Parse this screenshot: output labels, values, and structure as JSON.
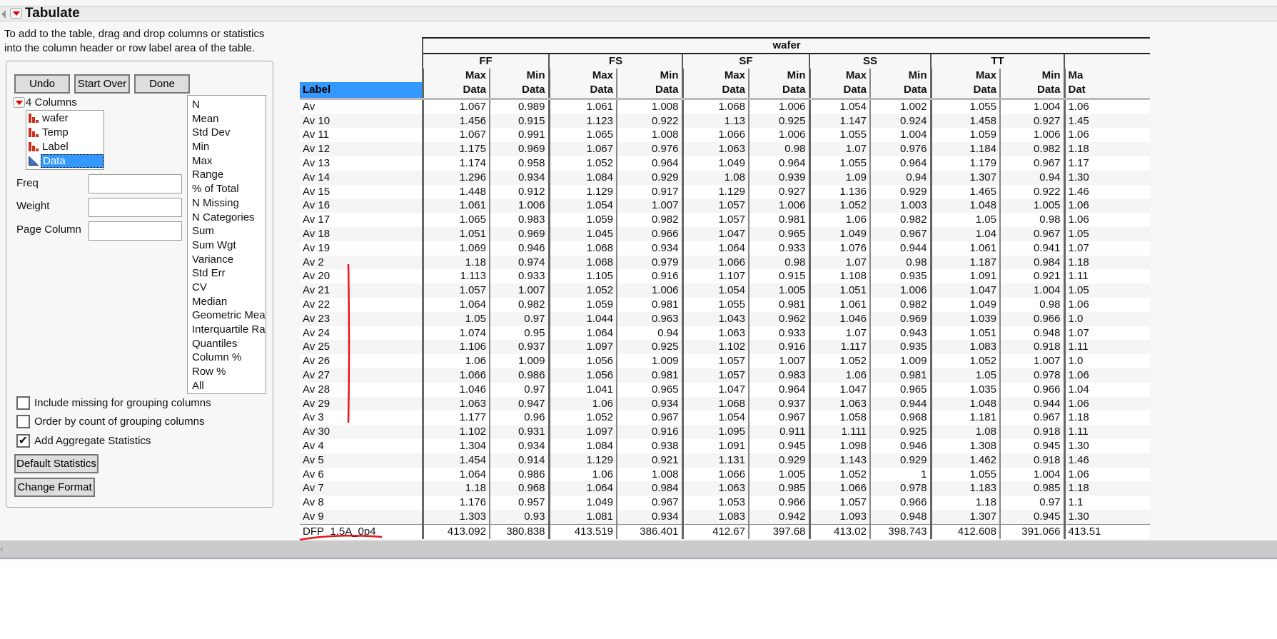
{
  "window": {
    "title": "Tabulate",
    "instructions_line1": "To add to the table, drag and drop columns or statistics",
    "instructions_line2": "into the column header or row label area of the table."
  },
  "buttons": {
    "undo": "Undo",
    "start_over": "Start Over",
    "done": "Done",
    "default_statistics": "Default Statistics",
    "change_format": "Change Format"
  },
  "columns_panel": {
    "header": "4 Columns",
    "items": [
      {
        "label": "wafer",
        "icon": "nominal-bar-icon"
      },
      {
        "label": "Temp",
        "icon": "nominal-bar-icon"
      },
      {
        "label": "Label",
        "icon": "nominal-bar-icon"
      },
      {
        "label": "Data",
        "icon": "continuous-icon",
        "selected": true
      }
    ]
  },
  "statistics": [
    "N",
    "Mean",
    "Std Dev",
    "Min",
    "Max",
    "Range",
    "% of Total",
    "N Missing",
    "N Categories",
    "Sum",
    "Sum Wgt",
    "Variance",
    "Std Err",
    "CV",
    "Median",
    "Geometric Mean",
    "Interquartile Range",
    "Quantiles",
    "Column %",
    "Row %",
    "All"
  ],
  "roles": {
    "freq": "Freq",
    "weight": "Weight",
    "page_column": "Page Column"
  },
  "options": [
    {
      "label": "Include missing for grouping columns",
      "checked": false
    },
    {
      "label": "Order by count of grouping columns",
      "checked": false
    },
    {
      "label": "Add Aggregate Statistics",
      "checked": true
    }
  ],
  "table": {
    "top_header": "wafer",
    "row_label_header": "Label",
    "groups": [
      "FF",
      "FS",
      "SF",
      "SS",
      "TT",
      ""
    ],
    "sub_headers": [
      "Max",
      "Min"
    ],
    "data_header": "Data",
    "partial_group_sub": "Ma",
    "partial_group_data": "Dat",
    "rows": [
      [
        "Av",
        "1.067",
        "0.989",
        "1.061",
        "1.008",
        "1.068",
        "1.006",
        "1.054",
        "1.002",
        "1.055",
        "1.004",
        "1.06"
      ],
      [
        "Av 10",
        "1.456",
        "0.915",
        "1.123",
        "0.922",
        "1.13",
        "0.925",
        "1.147",
        "0.924",
        "1.458",
        "0.927",
        "1.45"
      ],
      [
        "Av 11",
        "1.067",
        "0.991",
        "1.065",
        "1.008",
        "1.066",
        "1.006",
        "1.055",
        "1.004",
        "1.059",
        "1.006",
        "1.06"
      ],
      [
        "Av 12",
        "1.175",
        "0.969",
        "1.067",
        "0.976",
        "1.063",
        "0.98",
        "1.07",
        "0.976",
        "1.184",
        "0.982",
        "1.18"
      ],
      [
        "Av 13",
        "1.174",
        "0.958",
        "1.052",
        "0.964",
        "1.049",
        "0.964",
        "1.055",
        "0.964",
        "1.179",
        "0.967",
        "1.17"
      ],
      [
        "Av 14",
        "1.296",
        "0.934",
        "1.084",
        "0.929",
        "1.08",
        "0.939",
        "1.09",
        "0.94",
        "1.307",
        "0.94",
        "1.30"
      ],
      [
        "Av 15",
        "1.448",
        "0.912",
        "1.129",
        "0.917",
        "1.129",
        "0.927",
        "1.136",
        "0.929",
        "1.465",
        "0.922",
        "1.46"
      ],
      [
        "Av 16",
        "1.061",
        "1.006",
        "1.054",
        "1.007",
        "1.057",
        "1.006",
        "1.052",
        "1.003",
        "1.048",
        "1.005",
        "1.06"
      ],
      [
        "Av 17",
        "1.065",
        "0.983",
        "1.059",
        "0.982",
        "1.057",
        "0.981",
        "1.06",
        "0.982",
        "1.05",
        "0.98",
        "1.06"
      ],
      [
        "Av 18",
        "1.051",
        "0.969",
        "1.045",
        "0.966",
        "1.047",
        "0.965",
        "1.049",
        "0.967",
        "1.04",
        "0.967",
        "1.05"
      ],
      [
        "Av 19",
        "1.069",
        "0.946",
        "1.068",
        "0.934",
        "1.064",
        "0.933",
        "1.076",
        "0.944",
        "1.061",
        "0.941",
        "1.07"
      ],
      [
        "Av 2",
        "1.18",
        "0.974",
        "1.068",
        "0.979",
        "1.066",
        "0.98",
        "1.07",
        "0.98",
        "1.187",
        "0.984",
        "1.18"
      ],
      [
        "Av 20",
        "1.113",
        "0.933",
        "1.105",
        "0.916",
        "1.107",
        "0.915",
        "1.108",
        "0.935",
        "1.091",
        "0.921",
        "1.11"
      ],
      [
        "Av 21",
        "1.057",
        "1.007",
        "1.052",
        "1.006",
        "1.054",
        "1.005",
        "1.051",
        "1.006",
        "1.047",
        "1.004",
        "1.05"
      ],
      [
        "Av 22",
        "1.064",
        "0.982",
        "1.059",
        "0.981",
        "1.055",
        "0.981",
        "1.061",
        "0.982",
        "1.049",
        "0.98",
        "1.06"
      ],
      [
        "Av 23",
        "1.05",
        "0.97",
        "1.044",
        "0.963",
        "1.043",
        "0.962",
        "1.046",
        "0.969",
        "1.039",
        "0.966",
        "1.0"
      ],
      [
        "Av 24",
        "1.074",
        "0.95",
        "1.064",
        "0.94",
        "1.063",
        "0.933",
        "1.07",
        "0.943",
        "1.051",
        "0.948",
        "1.07"
      ],
      [
        "Av 25",
        "1.106",
        "0.937",
        "1.097",
        "0.925",
        "1.102",
        "0.916",
        "1.117",
        "0.935",
        "1.083",
        "0.918",
        "1.11"
      ],
      [
        "Av 26",
        "1.06",
        "1.009",
        "1.056",
        "1.009",
        "1.057",
        "1.007",
        "1.052",
        "1.009",
        "1.052",
        "1.007",
        "1.0"
      ],
      [
        "Av 27",
        "1.066",
        "0.986",
        "1.056",
        "0.981",
        "1.057",
        "0.983",
        "1.06",
        "0.981",
        "1.05",
        "0.978",
        "1.06"
      ],
      [
        "Av 28",
        "1.046",
        "0.97",
        "1.041",
        "0.965",
        "1.047",
        "0.964",
        "1.047",
        "0.965",
        "1.035",
        "0.966",
        "1.04"
      ],
      [
        "Av 29",
        "1.063",
        "0.947",
        "1.06",
        "0.934",
        "1.068",
        "0.937",
        "1.063",
        "0.944",
        "1.048",
        "0.944",
        "1.06"
      ],
      [
        "Av 3",
        "1.177",
        "0.96",
        "1.052",
        "0.967",
        "1.054",
        "0.967",
        "1.058",
        "0.968",
        "1.181",
        "0.967",
        "1.18"
      ],
      [
        "Av 30",
        "1.102",
        "0.931",
        "1.097",
        "0.916",
        "1.095",
        "0.911",
        "1.111",
        "0.925",
        "1.08",
        "0.918",
        "1.11"
      ],
      [
        "Av 4",
        "1.304",
        "0.934",
        "1.084",
        "0.938",
        "1.091",
        "0.945",
        "1.098",
        "0.946",
        "1.308",
        "0.945",
        "1.30"
      ],
      [
        "Av 5",
        "1.454",
        "0.914",
        "1.129",
        "0.921",
        "1.131",
        "0.929",
        "1.143",
        "0.929",
        "1.462",
        "0.918",
        "1.46"
      ],
      [
        "Av 6",
        "1.064",
        "0.986",
        "1.06",
        "1.008",
        "1.066",
        "1.005",
        "1.052",
        "1",
        "1.055",
        "1.004",
        "1.06"
      ],
      [
        "Av 7",
        "1.18",
        "0.968",
        "1.064",
        "0.984",
        "1.063",
        "0.985",
        "1.066",
        "0.978",
        "1.183",
        "0.985",
        "1.18"
      ],
      [
        "Av 8",
        "1.176",
        "0.957",
        "1.049",
        "0.967",
        "1.053",
        "0.966",
        "1.057",
        "0.966",
        "1.18",
        "0.97",
        "1.1"
      ],
      [
        "Av 9",
        "1.303",
        "0.93",
        "1.081",
        "0.934",
        "1.083",
        "0.942",
        "1.093",
        "0.948",
        "1.307",
        "0.945",
        "1.30"
      ],
      [
        "DFP_1.5A_0p4",
        "413.092",
        "380.838",
        "413.519",
        "386.401",
        "412.67",
        "397.68",
        "413.02",
        "398.743",
        "412.608",
        "391.066",
        "413.51"
      ]
    ]
  },
  "annotation_color": "#e8141e",
  "accent": "#3399ff"
}
